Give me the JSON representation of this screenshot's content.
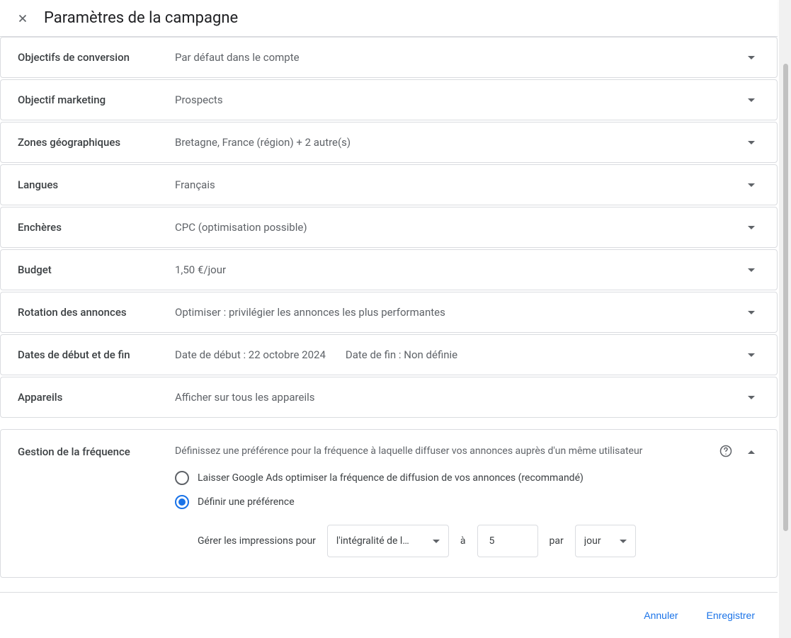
{
  "header": {
    "title": "Paramètres de la campagne"
  },
  "rows": {
    "conversion": {
      "label": "Objectifs de conversion",
      "value": "Par défaut dans le compte"
    },
    "marketing": {
      "label": "Objectif marketing",
      "value": "Prospects"
    },
    "geo": {
      "label": "Zones géographiques",
      "value": "Bretagne, France (région) + 2 autre(s)"
    },
    "lang": {
      "label": "Langues",
      "value": "Français"
    },
    "bid": {
      "label": "Enchères",
      "value": "CPC (optimisation possible)"
    },
    "budget": {
      "label": "Budget",
      "value": "1,50 €/jour"
    },
    "rotation": {
      "label": "Rotation des annonces",
      "value": "Optimiser : privilégier les annonces les plus performantes"
    },
    "dates": {
      "label": "Dates de début et de fin",
      "start": "Date de début : 22 octobre 2024",
      "end": "Date de fin : Non définie"
    },
    "devices": {
      "label": "Appareils",
      "value": "Afficher sur tous les appareils"
    }
  },
  "frequency": {
    "label": "Gestion de la fréquence",
    "desc": "Définissez une préférence pour la fréquence à laquelle diffuser vos annonces auprès d'un même utilisateur",
    "option_auto": "Laisser Google Ads optimiser la fréquence de diffusion de vos annonces (recommandé)",
    "option_manual": "Définir une préférence",
    "manage_label": "Gérer les impressions pour",
    "scope_value": "l'intégralité de l…",
    "to_label": "à",
    "count_value": "5",
    "per_label": "par",
    "period_value": "jour"
  },
  "footer": {
    "cancel": "Annuler",
    "save": "Enregistrer"
  }
}
